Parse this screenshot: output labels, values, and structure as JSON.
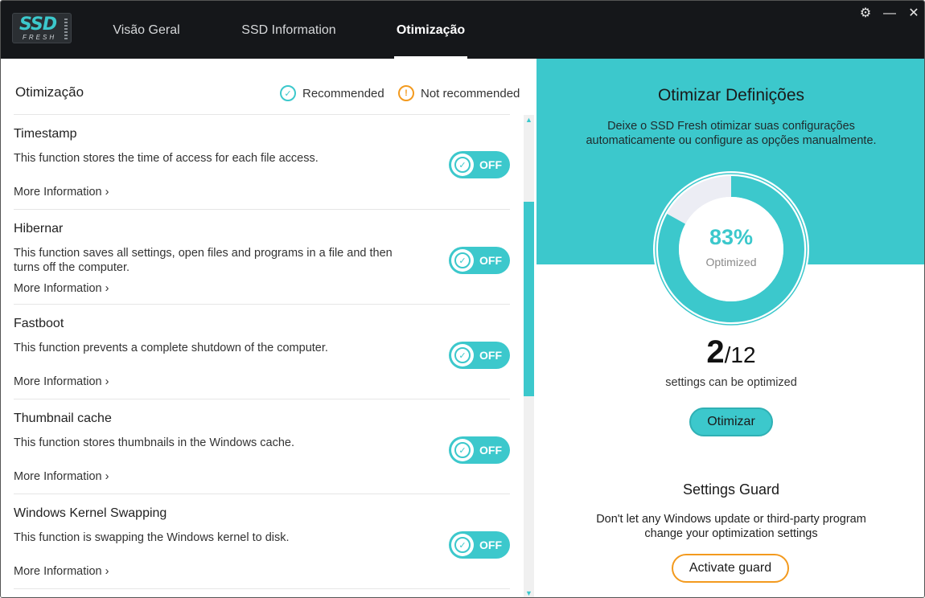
{
  "app": {
    "logo_main": "SSD",
    "logo_sub": "FRESH"
  },
  "tabs": [
    {
      "label": "Visão Geral",
      "active": false
    },
    {
      "label": "SSD Information",
      "active": false
    },
    {
      "label": "Otimização",
      "active": true
    }
  ],
  "window_controls": {
    "settings": "⚙",
    "minimize": "—",
    "close": "✕"
  },
  "left": {
    "header": "Otimização",
    "legend_recommended": "Recommended",
    "legend_not_recommended": "Not recommended",
    "more_label": "More Information",
    "toggle_label": "OFF",
    "items": [
      {
        "title": "Timestamp",
        "desc": "This function stores the time of access for each file access."
      },
      {
        "title": "Hibernar",
        "desc": "This function saves all settings, open files and programs in a file and then turns off the computer."
      },
      {
        "title": "Fastboot",
        "desc": "This function prevents a complete shutdown of the computer."
      },
      {
        "title": "Thumbnail cache",
        "desc": "This function stores thumbnails in the Windows cache."
      },
      {
        "title": "Windows Kernel Swapping",
        "desc": "This function is swapping the Windows kernel to disk."
      }
    ]
  },
  "right": {
    "title": "Otimizar Definições",
    "subtitle": "Deixe o SSD Fresh otimizar suas configurações automaticamente ou configure as opções manualmente.",
    "gauge_percent": "83%",
    "gauge_value": 0.83,
    "gauge_label": "Optimized",
    "count_done": "2",
    "count_total": "/12",
    "count_label": "settings can be optimized",
    "optimize_button": "Otimizar",
    "guard_title": "Settings Guard",
    "guard_subtitle": "Don't let any Windows update or third-party program change your optimization settings",
    "guard_button": "Activate guard"
  },
  "colors": {
    "accent": "#3cc8cc",
    "warning": "#f39a1e",
    "titlebar": "#15171a"
  }
}
